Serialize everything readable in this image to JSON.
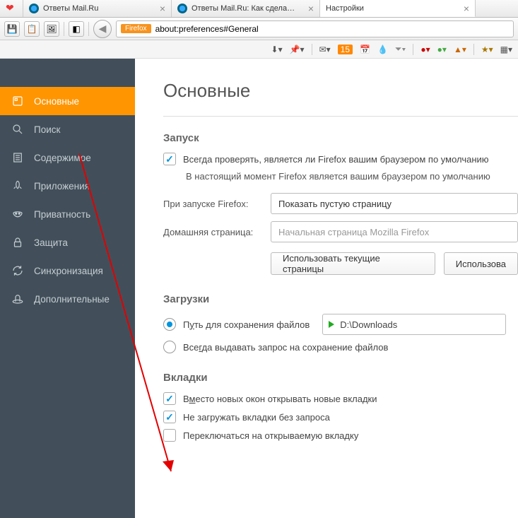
{
  "tabs": [
    {
      "label": "",
      "icon": "heart"
    },
    {
      "label": "Ответы Mail.Ru",
      "icon": "mail"
    },
    {
      "label": "Ответы Mail.Ru: Как сдела…",
      "icon": "mail"
    },
    {
      "label": "Настройки",
      "icon": "gear",
      "active": true
    }
  ],
  "toolbar": {
    "firefox_badge": "Firefox",
    "addressbar": "about:preferences#General",
    "tb2_badge_count": "15"
  },
  "sidebar": [
    {
      "id": "general",
      "label": "Основные",
      "icon": "general",
      "active": true
    },
    {
      "id": "search",
      "label": "Поиск",
      "icon": "search"
    },
    {
      "id": "content",
      "label": "Содержимое",
      "icon": "content"
    },
    {
      "id": "apps",
      "label": "Приложения",
      "icon": "apps"
    },
    {
      "id": "privacy",
      "label": "Приватность",
      "icon": "privacy"
    },
    {
      "id": "security",
      "label": "Защита",
      "icon": "security"
    },
    {
      "id": "sync",
      "label": "Синхронизация",
      "icon": "sync"
    },
    {
      "id": "advanced",
      "label": "Дополнительные",
      "icon": "advanced"
    }
  ],
  "content": {
    "title": "Основные",
    "startup": {
      "heading": "Запуск",
      "check_label": "Всегда проверять, является ли Firefox вашим браузером по умолчанию",
      "status": "В настоящий момент Firefox является вашим браузером по умолчанию",
      "when_start_label": "При запуске Firefox:",
      "when_start_value": "Показать пустую страницу",
      "home_label": "Домашняя страница:",
      "home_placeholder": "Начальная страница Mozilla Firefox",
      "btn_current": "Использовать текущие страницы",
      "btn_bookmark": "Использова"
    },
    "downloads": {
      "heading": "Загрузки",
      "save_to_label": "Путь для сохранения файлов",
      "path": "D:\\Downloads",
      "ask_label": "Всегда выдавать запрос на сохранение файлов"
    },
    "tabs_section": {
      "heading": "Вкладки",
      "open_in_tabs": "Вместо новых окон открывать новые вкладки",
      "dont_load": "Не загружать вкладки без запроса",
      "switch_to": "Переключаться на открываемую вкладку"
    }
  }
}
